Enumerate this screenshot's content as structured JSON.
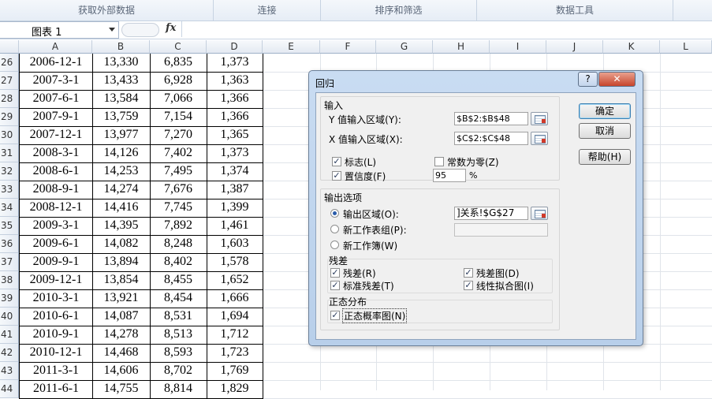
{
  "ribbon": {
    "groups": [
      "获取外部数据",
      "连接",
      "排序和筛选",
      "数据工具"
    ]
  },
  "formula_bar": {
    "name_box": "图表 1",
    "fx_label": "fx",
    "formula": ""
  },
  "columns": [
    "A",
    "B",
    "C",
    "D",
    "E",
    "F",
    "G",
    "H",
    "I",
    "J",
    "K",
    "L"
  ],
  "rows": [
    {
      "num": "26",
      "a": "2006-12-1",
      "b": "13,330",
      "c": "6,835",
      "d": "1,373"
    },
    {
      "num": "27",
      "a": "2007-3-1",
      "b": "13,433",
      "c": "6,928",
      "d": "1,363"
    },
    {
      "num": "28",
      "a": "2007-6-1",
      "b": "13,584",
      "c": "7,066",
      "d": "1,366"
    },
    {
      "num": "29",
      "a": "2007-9-1",
      "b": "13,759",
      "c": "7,154",
      "d": "1,366"
    },
    {
      "num": "30",
      "a": "2007-12-1",
      "b": "13,977",
      "c": "7,270",
      "d": "1,365"
    },
    {
      "num": "31",
      "a": "2008-3-1",
      "b": "14,126",
      "c": "7,402",
      "d": "1,373"
    },
    {
      "num": "32",
      "a": "2008-6-1",
      "b": "14,253",
      "c": "7,495",
      "d": "1,374"
    },
    {
      "num": "33",
      "a": "2008-9-1",
      "b": "14,274",
      "c": "7,676",
      "d": "1,387"
    },
    {
      "num": "34",
      "a": "2008-12-1",
      "b": "14,416",
      "c": "7,745",
      "d": "1,399"
    },
    {
      "num": "35",
      "a": "2009-3-1",
      "b": "14,395",
      "c": "7,892",
      "d": "1,461"
    },
    {
      "num": "36",
      "a": "2009-6-1",
      "b": "14,082",
      "c": "8,248",
      "d": "1,603"
    },
    {
      "num": "37",
      "a": "2009-9-1",
      "b": "13,894",
      "c": "8,402",
      "d": "1,578"
    },
    {
      "num": "38",
      "a": "2009-12-1",
      "b": "13,854",
      "c": "8,455",
      "d": "1,652"
    },
    {
      "num": "39",
      "a": "2010-3-1",
      "b": "13,921",
      "c": "8,454",
      "d": "1,666"
    },
    {
      "num": "40",
      "a": "2010-6-1",
      "b": "14,087",
      "c": "8,531",
      "d": "1,694"
    },
    {
      "num": "41",
      "a": "2010-9-1",
      "b": "14,278",
      "c": "8,513",
      "d": "1,712"
    },
    {
      "num": "42",
      "a": "2010-12-1",
      "b": "14,468",
      "c": "8,593",
      "d": "1,723"
    },
    {
      "num": "43",
      "a": "2011-3-1",
      "b": "14,606",
      "c": "8,702",
      "d": "1,769"
    },
    {
      "num": "44",
      "a": "2011-6-1",
      "b": "14,755",
      "c": "8,814",
      "d": "1,829"
    }
  ],
  "dialog": {
    "title": "回归",
    "help_glyph": "?",
    "close_glyph": "✕",
    "input_group": "输入",
    "y_range_label": "Y 值输入区域(Y):",
    "y_range_value": "$B$2:$B$48",
    "x_range_label": "X 值输入区域(X):",
    "x_range_value": "$C$2:$C$48",
    "labels_check": "标志(L)",
    "labels_checked": true,
    "const_zero_check": "常数为零(Z)",
    "const_zero_checked": false,
    "confidence_check": "置信度(F)",
    "confidence_checked": true,
    "confidence_value": "95",
    "confidence_unit": "%",
    "output_group": "输出选项",
    "output_range_radio": "输出区域(O):",
    "output_range_value": "]关系!$G$27",
    "new_sheet_radio": "新工作表组(P):",
    "new_sheet_value": "",
    "new_workbook_radio": "新工作簿(W)",
    "selected_output": "output_range",
    "residuals_group": "残差",
    "residuals_check": "残差(R)",
    "residual_plots_check": "残差图(D)",
    "std_residuals_check": "标准残差(T)",
    "line_fit_check": "线性拟合图(I)",
    "normal_group": "正态分布",
    "normal_plot_check": "正态概率图(N)",
    "ok_button": "确定",
    "cancel_button": "取消",
    "help_button": "帮助(H)",
    "check_mark": "✓"
  }
}
